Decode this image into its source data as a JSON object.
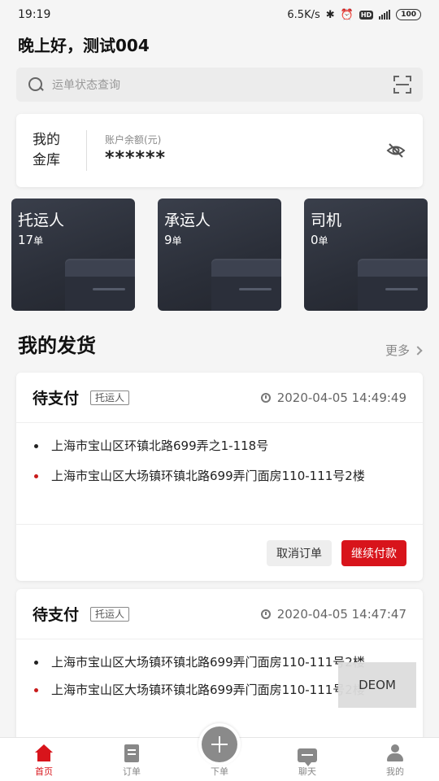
{
  "status_bar": {
    "time": "19:19",
    "net_speed": "6.5K/s",
    "bluetooth_glyph": "✱",
    "alarm_glyph": "⏰",
    "hd_label": "HD",
    "battery": "100"
  },
  "greeting": "晚上好，测试004",
  "search": {
    "placeholder": "运单状态查询"
  },
  "vault": {
    "title_line1": "我的",
    "title_line2": "金库",
    "balance_label": "账户余额(元)",
    "balance_value": "******"
  },
  "roles": [
    {
      "name": "托运人",
      "count": "17",
      "unit": "单"
    },
    {
      "name": "承运人",
      "count": "9",
      "unit": "单"
    },
    {
      "name": "司机",
      "count": "0",
      "unit": "单"
    }
  ],
  "section": {
    "title": "我的发货",
    "more_label": "更多"
  },
  "orders": [
    {
      "status": "待支付",
      "tag": "托运人",
      "time": "2020-04-05 14:49:49",
      "from": "上海市宝山区环镇北路699弄之1-118号",
      "to": "上海市宝山区大场镇环镇北路699弄门面房110-111号2楼",
      "cancel_label": "取消订单",
      "pay_label": "继续付款"
    },
    {
      "status": "待支付",
      "tag": "托运人",
      "time": "2020-04-05 14:47:47",
      "from": "上海市宝山区大场镇环镇北路699弄门面房110-111号2楼",
      "to": "上海市宝山区大场镇环镇北路699弄门面房110-111号2楼"
    }
  ],
  "overlay": {
    "label": "DEOM"
  },
  "nav": {
    "home": "首页",
    "orders": "订单",
    "create": "下单",
    "chat": "聊天",
    "mine": "我的"
  },
  "colors": {
    "accent": "#d8141b",
    "card_dark": "#2a2e38"
  }
}
